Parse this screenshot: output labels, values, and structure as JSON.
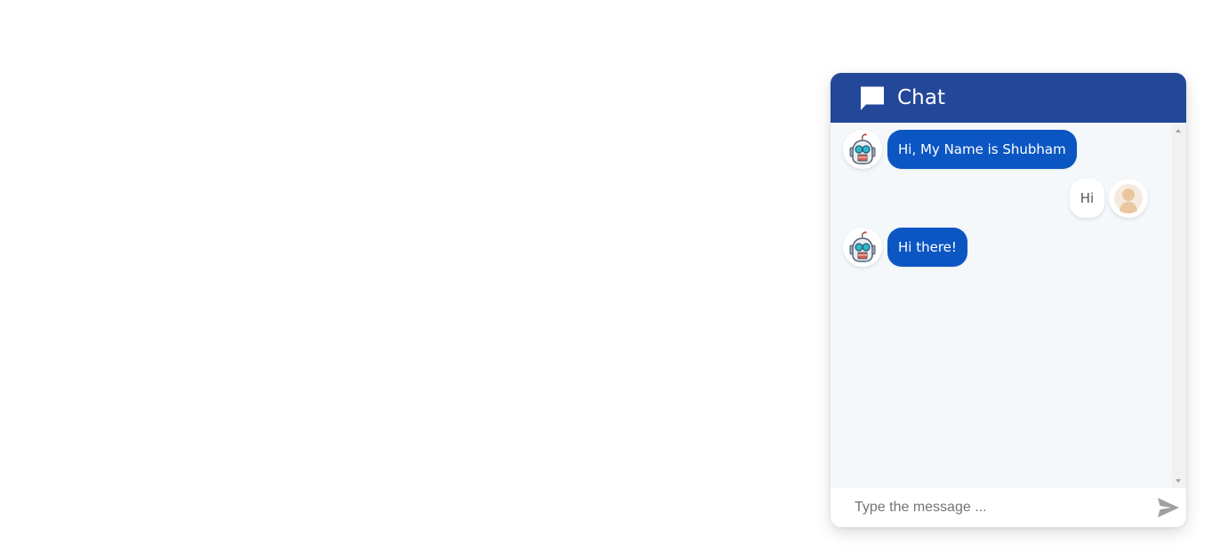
{
  "chat": {
    "title": "Chat",
    "header_icon": "chat-icon",
    "messages": [
      {
        "sender": "bot",
        "avatar": "robot-avatar",
        "text": "Hi, My Name is Shubham"
      },
      {
        "sender": "user",
        "avatar": "user-avatar",
        "text": "Hi"
      },
      {
        "sender": "bot",
        "avatar": "robot-avatar",
        "text": "Hi there!"
      }
    ],
    "input": {
      "placeholder": "Type the message ...",
      "value": ""
    },
    "send_icon": "send-icon"
  },
  "colors": {
    "header": "#23489a",
    "bot_bubble": "#0c56c3",
    "messages_background": "#f4f8fb",
    "page_background": "#ffffff"
  }
}
